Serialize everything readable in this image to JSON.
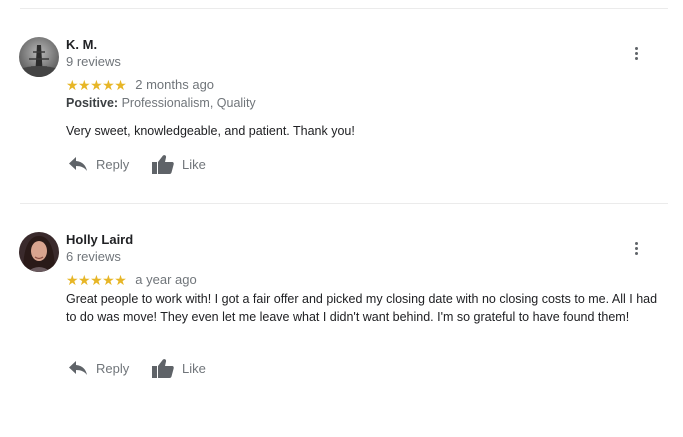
{
  "reviews": [
    {
      "name": "K. M.",
      "review_count": "9 reviews",
      "stars": "★★★★★",
      "time": "2 months ago",
      "attrs_label": "Positive:",
      "attrs_value": "Professionalism, Quality",
      "text": "Very sweet, knowledgeable, and patient. Thank you!",
      "reply_label": "Reply",
      "like_label": "Like"
    },
    {
      "name": "Holly Laird",
      "review_count": "6 reviews",
      "stars": "★★★★★",
      "time": "a year ago",
      "text": "Great people to work with! I got a fair offer and picked my closing date with no closing costs to me. All I had to do was move! They even let me leave what I didn't want behind. I'm so grateful to have found them!",
      "reply_label": "Reply",
      "like_label": "Like"
    }
  ],
  "colors": {
    "star": "#e7b627",
    "muted_text": "#70757a",
    "icon": "#5f6368"
  },
  "icons": [
    "more-vert-icon",
    "reply-icon",
    "thumb-up-icon"
  ]
}
